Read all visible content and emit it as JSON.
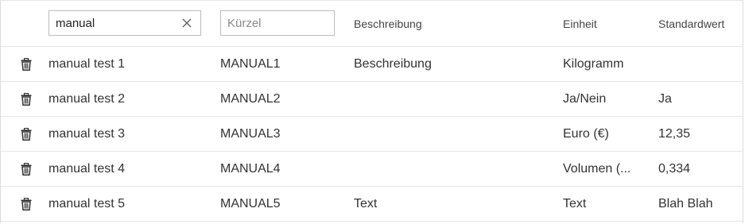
{
  "filters": {
    "name_value": "manual",
    "short_placeholder": "Kürzel"
  },
  "headers": {
    "description": "Beschreibung",
    "unit": "Einheit",
    "default": "Standardwert"
  },
  "icons": {
    "delete": "trash-icon",
    "clear": "close-icon"
  },
  "rows": [
    {
      "name": "manual test 1",
      "short": "MANUAL1",
      "description": "Beschreibung",
      "unit": "Kilogramm",
      "default": ""
    },
    {
      "name": "manual test 2",
      "short": "MANUAL2",
      "description": "",
      "unit": "Ja/Nein",
      "default": "Ja"
    },
    {
      "name": "manual test 3",
      "short": "MANUAL3",
      "description": "",
      "unit": "Euro (€)",
      "default": "12,35"
    },
    {
      "name": "manual test 4",
      "short": "MANUAL4",
      "description": "",
      "unit": "Volumen (...",
      "default": "0,334"
    },
    {
      "name": "manual test 5",
      "short": "MANUAL5",
      "description": "Text",
      "unit": "Text",
      "default": "Blah Blah"
    }
  ]
}
